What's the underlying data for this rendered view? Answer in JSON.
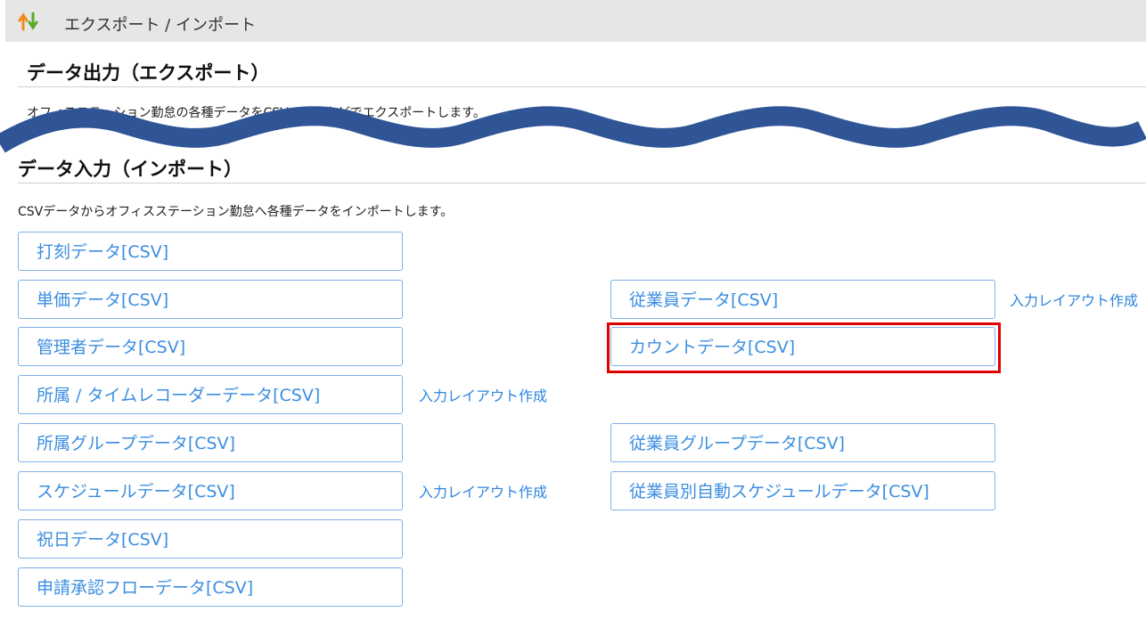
{
  "header": {
    "title": "エクスポート / インポート",
    "icon": "up-down-arrows-icon"
  },
  "export": {
    "title": "データ出力（エクスポート）",
    "description": "オフィスステーション勤怠の各種データをCSV、PDFなどでエクスポートします。"
  },
  "import": {
    "title": "データ入力（インポート）",
    "description": "CSVデータからオフィスステーション勤怠へ各種データをインポートします。",
    "left_buttons": [
      "打刻データ[CSV]",
      "単価データ[CSV]",
      "管理者データ[CSV]",
      "所属 / タイムレコーダーデータ[CSV]",
      "所属グループデータ[CSV]",
      "スケジュールデータ[CSV]",
      "祝日データ[CSV]",
      "申請承認フローデータ[CSV]"
    ],
    "right_buttons": [
      "従業員データ[CSV]",
      "カウントデータ[CSV]",
      "従業員グループデータ[CSV]",
      "従業員別自動スケジュールデータ[CSV]"
    ],
    "layout_link": "入力レイアウト作成"
  },
  "colors": {
    "accent": "#3b8ee0",
    "highlight": "#e00000",
    "wave": "#2f5597"
  }
}
